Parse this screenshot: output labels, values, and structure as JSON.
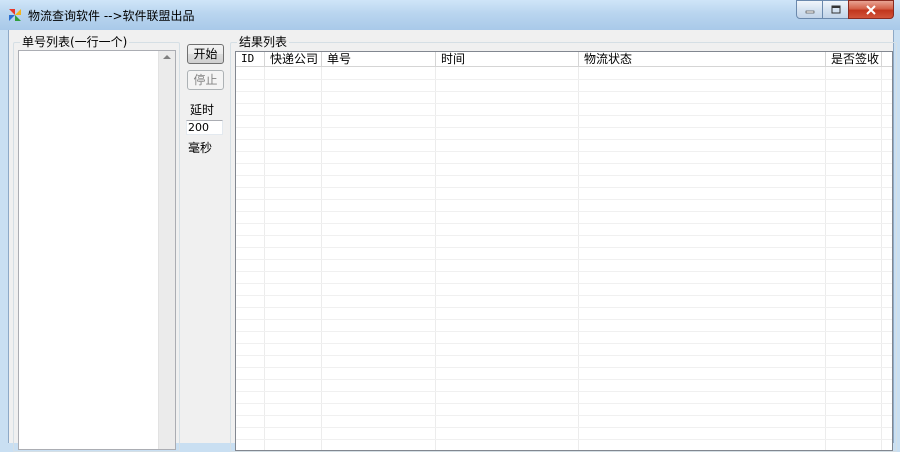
{
  "window": {
    "title": "物流查询软件 -->软件联盟出品"
  },
  "left_panel": {
    "group_label": "单号列表(一行一个)"
  },
  "controls": {
    "start_label": "开始",
    "stop_label": "停止",
    "delay_label": "延时",
    "delay_value": "200",
    "unit_label": "毫秒"
  },
  "results": {
    "group_label": "结果列表",
    "columns": [
      "ID",
      "快递公司",
      "单号",
      "时间",
      "物流状态",
      "是否签收"
    ]
  },
  "icons": {
    "app": "pinwheel-app-icon",
    "minimize": "minimize-icon",
    "maximize": "maximize-icon",
    "close": "close-icon",
    "scroll_up": "scroll-up-arrow-icon"
  },
  "colors": {
    "close_button": "#c1351d",
    "titlebar": "#b9d5ef"
  }
}
